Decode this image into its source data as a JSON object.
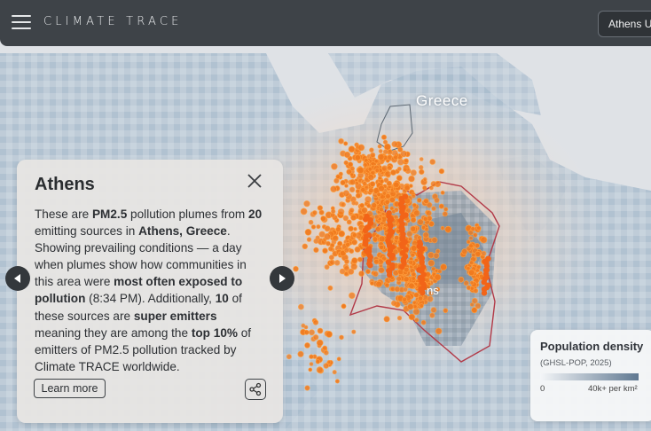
{
  "app": {
    "brand": "CLIMATE TRACE",
    "location_chip": "Athens U"
  },
  "map": {
    "labels": {
      "country": "Greece",
      "city_fragment": "ns"
    }
  },
  "info_card": {
    "title": "Athens",
    "body": [
      {
        "t": "These are "
      },
      {
        "t": "PM2.5",
        "b": true
      },
      {
        "t": " pollution plumes from "
      },
      {
        "t": "20",
        "b": true
      },
      {
        "t": " emitting sources in "
      },
      {
        "t": "Athens, Greece",
        "b": true
      },
      {
        "t": ". Showing prevailing conditions — a day when plumes show how communities in this area were "
      },
      {
        "t": "most often exposed to pollution",
        "b": true
      },
      {
        "t": " (8:34 PM). Additionally, "
      },
      {
        "t": "10",
        "b": true
      },
      {
        "t": " of these sources are "
      },
      {
        "t": "super emitters",
        "b": true
      },
      {
        "t": " meaning they are among the "
      },
      {
        "t": "top 10%",
        "b": true
      },
      {
        "t": " of emitters of PM2.5 pollution tracked by Climate TRACE worldwide."
      }
    ],
    "learn_more_label": "Learn more",
    "close_icon": "close-icon",
    "share_icon": "share-icon"
  },
  "carousel": {
    "prev_icon": "triangle-left-icon",
    "next_icon": "triangle-right-icon"
  },
  "legend": {
    "title": "Population density",
    "source": "(GHSL-POP, 2025)",
    "min_label": "0",
    "max_label": "40k+ per km²",
    "color_low": "#f4f6f8",
    "color_high": "#5f7891"
  },
  "colors": {
    "topbar": "#3e4348",
    "plume_dot": "#f07a1e",
    "plume_dot_edge": "#ffa142",
    "boundary": "#b23a48"
  }
}
